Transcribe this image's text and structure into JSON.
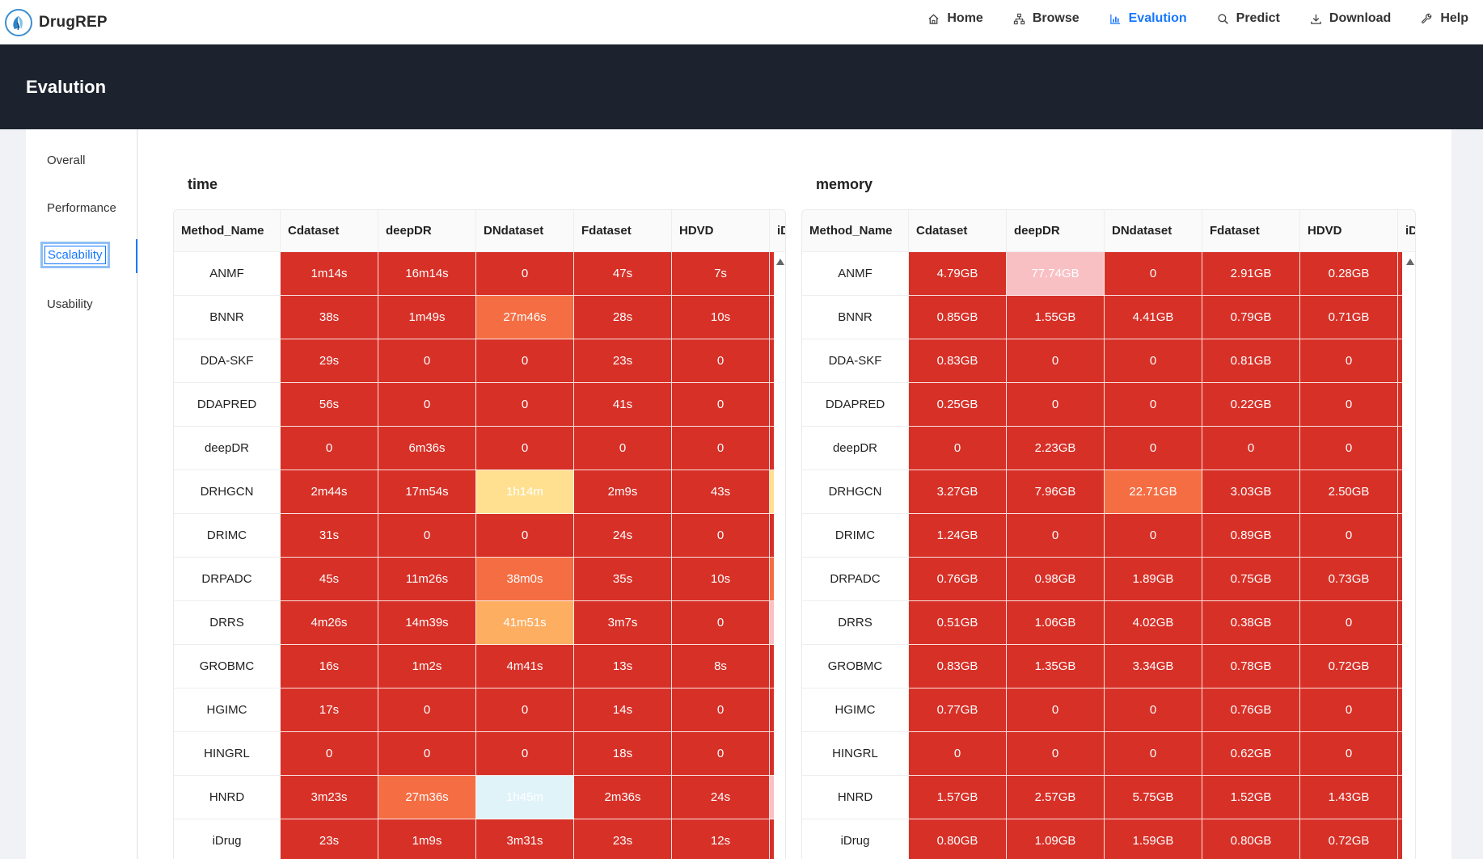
{
  "app": {
    "name": "DrugREP"
  },
  "nav": {
    "items": [
      {
        "label": "Home",
        "icon": "home-icon"
      },
      {
        "label": "Browse",
        "icon": "sitemap-icon"
      },
      {
        "label": "Evalution",
        "icon": "bar-chart-icon",
        "active": true
      },
      {
        "label": "Predict",
        "icon": "search-icon"
      },
      {
        "label": "Download",
        "icon": "download-icon"
      },
      {
        "label": "Help",
        "icon": "wrench-icon"
      }
    ],
    "active_color": "#1677ff"
  },
  "banner": {
    "title": "Evalution"
  },
  "sidebar": {
    "items": [
      {
        "label": "Overall"
      },
      {
        "label": "Performance"
      },
      {
        "label": "Scalability",
        "active": true
      },
      {
        "label": "Usability"
      }
    ]
  },
  "colors": {
    "red": "#d73027",
    "orange": "#f46d43",
    "lightorange": "#fdae61",
    "yellow": "#fee090",
    "pink": "#f9c0c4",
    "lightblue": "#e0f3f8"
  },
  "tables": {
    "columns": [
      "Method_Name",
      "Cdataset",
      "deepDR",
      "DNdataset",
      "Fdataset",
      "HDVD",
      "iD"
    ],
    "time": {
      "title": "time",
      "rows": [
        {
          "name": "ANMF",
          "values": [
            "1m14s",
            "16m14s",
            "0",
            "47s",
            "7s"
          ],
          "colors": [
            "red",
            "red",
            "red",
            "red",
            "red",
            "red"
          ]
        },
        {
          "name": "BNNR",
          "values": [
            "38s",
            "1m49s",
            "27m46s",
            "28s",
            "10s"
          ],
          "colors": [
            "red",
            "red",
            "orange",
            "red",
            "red",
            "red"
          ]
        },
        {
          "name": "DDA-SKF",
          "values": [
            "29s",
            "0",
            "0",
            "23s",
            "0"
          ],
          "colors": [
            "red",
            "red",
            "red",
            "red",
            "red",
            "red"
          ]
        },
        {
          "name": "DDAPRED",
          "values": [
            "56s",
            "0",
            "0",
            "41s",
            "0"
          ],
          "colors": [
            "red",
            "red",
            "red",
            "red",
            "red",
            "red"
          ]
        },
        {
          "name": "deepDR",
          "values": [
            "0",
            "6m36s",
            "0",
            "0",
            "0"
          ],
          "colors": [
            "red",
            "red",
            "red",
            "red",
            "red",
            "red"
          ]
        },
        {
          "name": "DRHGCN",
          "values": [
            "2m44s",
            "17m54s",
            "1h14m",
            "2m9s",
            "43s"
          ],
          "colors": [
            "red",
            "red",
            "yellow",
            "red",
            "red",
            "yellow"
          ]
        },
        {
          "name": "DRIMC",
          "values": [
            "31s",
            "0",
            "0",
            "24s",
            "0"
          ],
          "colors": [
            "red",
            "red",
            "red",
            "red",
            "red",
            "red"
          ]
        },
        {
          "name": "DRPADC",
          "values": [
            "45s",
            "11m26s",
            "38m0s",
            "35s",
            "10s"
          ],
          "colors": [
            "red",
            "red",
            "orange",
            "red",
            "red",
            "orange"
          ]
        },
        {
          "name": "DRRS",
          "values": [
            "4m26s",
            "14m39s",
            "41m51s",
            "3m7s",
            "0"
          ],
          "colors": [
            "red",
            "red",
            "lightorange",
            "red",
            "red",
            "pink"
          ]
        },
        {
          "name": "GROBMC",
          "values": [
            "16s",
            "1m2s",
            "4m41s",
            "13s",
            "8s"
          ],
          "colors": [
            "red",
            "red",
            "red",
            "red",
            "red",
            "red"
          ]
        },
        {
          "name": "HGIMC",
          "values": [
            "17s",
            "0",
            "0",
            "14s",
            "0"
          ],
          "colors": [
            "red",
            "red",
            "red",
            "red",
            "red",
            "red"
          ]
        },
        {
          "name": "HINGRL",
          "values": [
            "0",
            "0",
            "0",
            "18s",
            "0"
          ],
          "colors": [
            "red",
            "red",
            "red",
            "red",
            "red",
            "red"
          ]
        },
        {
          "name": "HNRD",
          "values": [
            "3m23s",
            "27m36s",
            "1h45m",
            "2m36s",
            "24s"
          ],
          "colors": [
            "red",
            "orange",
            "lightblue",
            "red",
            "red",
            "pink"
          ]
        },
        {
          "name": "iDrug",
          "values": [
            "23s",
            "1m9s",
            "3m31s",
            "23s",
            "12s"
          ],
          "colors": [
            "red",
            "red",
            "red",
            "red",
            "red",
            "red"
          ]
        }
      ]
    },
    "memory": {
      "title": "memory",
      "rows": [
        {
          "name": "ANMF",
          "values": [
            "4.79GB",
            "77.74GB",
            "0",
            "2.91GB",
            "0.28GB"
          ],
          "colors": [
            "red",
            "pink",
            "red",
            "red",
            "red",
            "red"
          ]
        },
        {
          "name": "BNNR",
          "values": [
            "0.85GB",
            "1.55GB",
            "4.41GB",
            "0.79GB",
            "0.71GB"
          ],
          "colors": [
            "red",
            "red",
            "red",
            "red",
            "red",
            "red"
          ]
        },
        {
          "name": "DDA-SKF",
          "values": [
            "0.83GB",
            "0",
            "0",
            "0.81GB",
            "0"
          ],
          "colors": [
            "red",
            "red",
            "red",
            "red",
            "red",
            "red"
          ]
        },
        {
          "name": "DDAPRED",
          "values": [
            "0.25GB",
            "0",
            "0",
            "0.22GB",
            "0"
          ],
          "colors": [
            "red",
            "red",
            "red",
            "red",
            "red",
            "red"
          ]
        },
        {
          "name": "deepDR",
          "values": [
            "0",
            "2.23GB",
            "0",
            "0",
            "0"
          ],
          "colors": [
            "red",
            "red",
            "red",
            "red",
            "red",
            "red"
          ]
        },
        {
          "name": "DRHGCN",
          "values": [
            "3.27GB",
            "7.96GB",
            "22.71GB",
            "3.03GB",
            "2.50GB"
          ],
          "colors": [
            "red",
            "red",
            "orange",
            "red",
            "red",
            "red"
          ]
        },
        {
          "name": "DRIMC",
          "values": [
            "1.24GB",
            "0",
            "0",
            "0.89GB",
            "0"
          ],
          "colors": [
            "red",
            "red",
            "red",
            "red",
            "red",
            "red"
          ]
        },
        {
          "name": "DRPADC",
          "values": [
            "0.76GB",
            "0.98GB",
            "1.89GB",
            "0.75GB",
            "0.73GB"
          ],
          "colors": [
            "red",
            "red",
            "red",
            "red",
            "red",
            "red"
          ]
        },
        {
          "name": "DRRS",
          "values": [
            "0.51GB",
            "1.06GB",
            "4.02GB",
            "0.38GB",
            "0"
          ],
          "colors": [
            "red",
            "red",
            "red",
            "red",
            "red",
            "red"
          ]
        },
        {
          "name": "GROBMC",
          "values": [
            "0.83GB",
            "1.35GB",
            "3.34GB",
            "0.78GB",
            "0.72GB"
          ],
          "colors": [
            "red",
            "red",
            "red",
            "red",
            "red",
            "red"
          ]
        },
        {
          "name": "HGIMC",
          "values": [
            "0.77GB",
            "0",
            "0",
            "0.76GB",
            "0"
          ],
          "colors": [
            "red",
            "red",
            "red",
            "red",
            "red",
            "red"
          ]
        },
        {
          "name": "HINGRL",
          "values": [
            "0",
            "0",
            "0",
            "0.62GB",
            "0"
          ],
          "colors": [
            "red",
            "red",
            "red",
            "red",
            "red",
            "red"
          ]
        },
        {
          "name": "HNRD",
          "values": [
            "1.57GB",
            "2.57GB",
            "5.75GB",
            "1.52GB",
            "1.43GB"
          ],
          "colors": [
            "red",
            "red",
            "red",
            "red",
            "red",
            "red"
          ]
        },
        {
          "name": "iDrug",
          "values": [
            "0.80GB",
            "1.09GB",
            "1.59GB",
            "0.80GB",
            "0.72GB"
          ],
          "colors": [
            "red",
            "red",
            "red",
            "red",
            "red",
            "red"
          ]
        }
      ]
    }
  }
}
